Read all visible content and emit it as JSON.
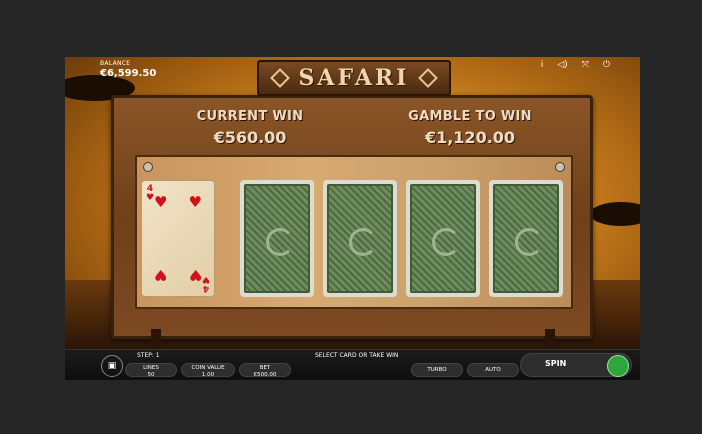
{
  "balance": {
    "label": "BALANCE",
    "value": "€6,599.50"
  },
  "top_icons": [
    "info-icon",
    "sound-icon",
    "fullscreen-icon",
    "power-icon"
  ],
  "logo": {
    "title": "SAFARI"
  },
  "current_win": {
    "label": "CURRENT WIN",
    "value": "€560.00"
  },
  "gamble_to_win": {
    "label": "GAMBLE TO WIN",
    "value": "€1,120.00"
  },
  "dealer_card": {
    "rank": "4",
    "suit": "♥",
    "color": "#d0121a"
  },
  "hidden_cards": 4,
  "bottom": {
    "step": "STEP: 1",
    "message": "SELECT CARD OR TAKE WIN",
    "lines_label": "LINES",
    "lines_value": "50",
    "coin_label": "COIN VALUE",
    "coin_value": "1.00",
    "bet_label": "BET",
    "bet_value": "€500.00",
    "turbo": "TURBO",
    "auto": "AUTO",
    "spin": "SPIN"
  }
}
